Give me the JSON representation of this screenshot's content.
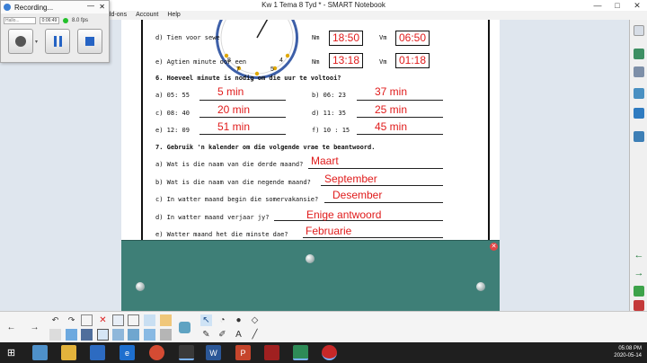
{
  "window": {
    "title": "Kw 1 Tema 8 Tyd * - SMART Notebook",
    "min": "—",
    "max": "□",
    "close": "✕"
  },
  "menu": [
    "Add-ons",
    "Account",
    "Help"
  ],
  "recorder": {
    "title": "Recording...",
    "volume": "Hallo...",
    "time": "0:06:49",
    "fps": "8.0 fps"
  },
  "doc": {
    "row_d_text": "d)  Tien voor sewe",
    "row_e_text": "e)  Agtien minute oor een",
    "nm_label": "Nm",
    "vm_label": "Vm",
    "row_d_nm": "18:50",
    "row_d_vm": "06:50",
    "row_e_nm": "13:18",
    "row_e_vm": "01:18",
    "q6": "6.  Hoeveel minute is nodig om die uur te voltooi?",
    "q6_items": [
      {
        "label": "a)  05: 55",
        "answer": "5 min"
      },
      {
        "label": "b)  06: 23",
        "answer": "37 min"
      },
      {
        "label": "c)  08: 40",
        "answer": "20 min"
      },
      {
        "label": "d)  11: 35",
        "answer": "25 min"
      },
      {
        "label": "e)  12: 09",
        "answer": "51 min"
      },
      {
        "label": "f)  10 : 15",
        "answer": "45 min"
      }
    ],
    "q7": "7.  Gebruik 'n kalender om die volgende vrae te beantwoord.",
    "q7_items": [
      {
        "label": "a) Wat is die naam van die derde maand?",
        "answer": "Maart"
      },
      {
        "label": "b) Wat is die naam van die negende maand?",
        "answer": "September"
      },
      {
        "label": "c) In watter maand begin die somervakansie?",
        "answer": "Desember"
      },
      {
        "label": "d) In watter maand verjaar jy?",
        "answer": "Enige antwoord"
      },
      {
        "label": "e) Watter maand het die minste dae?",
        "answer": "Februarie"
      }
    ]
  },
  "taskbar": {
    "time": "05:08 PM",
    "date": "2020-05-14"
  }
}
